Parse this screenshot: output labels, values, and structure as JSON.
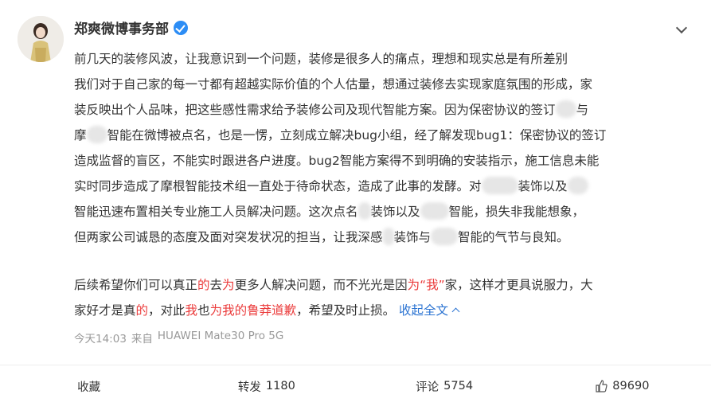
{
  "user": {
    "name": "郑爽微博事务部",
    "verified": true
  },
  "post": {
    "lines": [
      "前几天的装修风波，让我意识到一个问题，装修是很多人的痛点，理想和现实总是有所差别",
      "我们对于自己家的每一寸都有超越实际价值的个人估量，想通过装修去实现家庭氛围的形成，家",
      "装反映出个人品味，把这些感性需求给予装修公司及现代智能方案。因为保密协议的签订",
      "智能在微博被点名，也是一愣，立刻成立解决bug小组，经了解发现bug1：保密协议的签订",
      "造成监督的盲区，不能实时跟进各户进度。bug2智能方案得不到明确的安装指示，施工信息未能",
      "实时同步造成了摩根智能技术组一直处于待命状态，造成了此事的发酵。对",
      "智能迅速布置相关专业施工人员解决问题。这次点名",
      "但两家公司诚恳的态度及面对突发状况的担当，让我深感"
    ],
    "fragments": {
      "l3_end": "与",
      "l4_start": "摩",
      "l6_mid": "装饰以及",
      "l7_a": "装饰以及",
      "l7_b": "智能，损失非我能想象，",
      "l8_a": "装饰与",
      "l8_b": "智能的气节与良知。"
    },
    "second_para": {
      "a": "后续希望你们可以真正",
      "b": "的",
      "c": "去",
      "d": "为",
      "e": "更多人解决问题，而不光光是因",
      "f": "为“我”",
      "g": "家，这样才更具说服力，大",
      "h": "家好才是真",
      "i": "的",
      "j": "，对此",
      "k": "我",
      "l": "也",
      "m": "为我的鲁莽道歉",
      "n": "，希望及时止损。"
    },
    "expand_label": "收起全文"
  },
  "meta": {
    "time": "今天14:03",
    "source_prefix": "来自",
    "device": "HUAWEI Mate30 Pro 5G"
  },
  "actions": {
    "favorite": "收藏",
    "repost_label": "转发",
    "repost_count": "1180",
    "comment_label": "评论",
    "comment_count": "5754",
    "like_count": "89690"
  },
  "colors": {
    "link": "#2c74d2",
    "highlight": "#eb3c3c",
    "verified": "#2c8df5"
  },
  "icons": [
    "avatar",
    "verified-icon",
    "chevron-down-icon",
    "thumbs-up-icon"
  ]
}
